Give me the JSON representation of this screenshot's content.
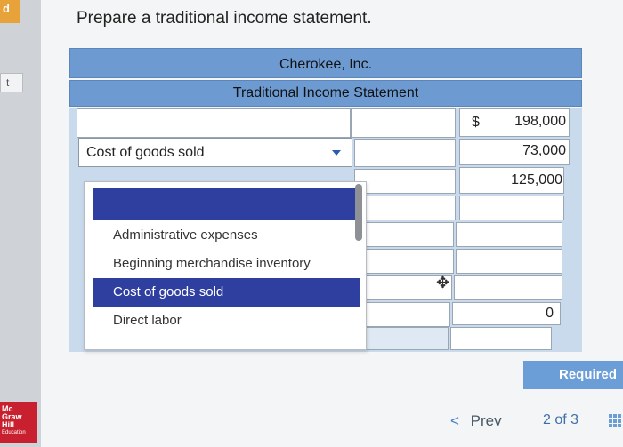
{
  "task": {
    "prompt": "Prepare a traditional income statement."
  },
  "statement": {
    "company": "Cherokee, Inc.",
    "title": "Traditional Income Statement",
    "dollar_sign": "$",
    "rows": [
      {
        "label": "",
        "amount": "198,000"
      },
      {
        "label": "Cost of goods sold",
        "amount": "73,000"
      },
      {
        "label": "",
        "amount": "125,000"
      },
      {
        "label": "",
        "amount": ""
      },
      {
        "label": "",
        "amount": ""
      },
      {
        "label": "",
        "amount": ""
      },
      {
        "label": "",
        "amount": "0"
      },
      {
        "label": "",
        "amount": ""
      }
    ]
  },
  "dropdown": {
    "options": [
      "",
      "Administrative expenses",
      "Beginning merchandise inventory",
      "Cost of goods sold",
      "Direct labor"
    ],
    "selected": "Cost of goods sold"
  },
  "left_rail": {
    "tab_top": "d",
    "tab_mid": "t",
    "logo": [
      "Mc",
      "Graw",
      "Hill",
      "Education"
    ]
  },
  "footer": {
    "required_label": "Required",
    "prev_label": "Prev",
    "page_current": "2",
    "page_sep": "of",
    "page_total": "3"
  },
  "colors": {
    "header_blue": "#6d9bd1",
    "selected_option": "#2f3fa0",
    "required_button": "#6b9ed6"
  },
  "icons": {
    "dropdown_caret": "caret-down-icon",
    "move_cursor": "move-cursor-icon",
    "prev_chevron": "chevron-left-icon",
    "grid": "grid-icon"
  }
}
